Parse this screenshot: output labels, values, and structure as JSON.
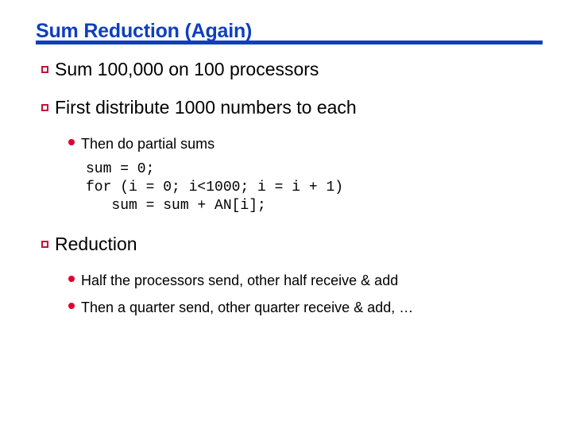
{
  "slide": {
    "title": "Sum Reduction (Again)",
    "title_color": "#0F3FBF",
    "bullet_square_color": "#C8103C",
    "bullet_dot_color": "#E00030",
    "background_color": "#FFFFFF",
    "text_color": "#000000",
    "bullets": [
      {
        "level": 1,
        "marker": "hollow-square-bullet",
        "text": "Sum 100,000 on 100 processors"
      },
      {
        "level": 1,
        "marker": "hollow-square-bullet",
        "text": "First distribute 1000 numbers to each"
      },
      {
        "level": 2,
        "marker": "filled-round-bullet",
        "text": "Then do partial sums"
      },
      {
        "level": 1,
        "marker": "hollow-square-bullet",
        "text": "Reduction"
      },
      {
        "level": 2,
        "marker": "filled-round-bullet",
        "text": "Half the processors send, other half receive & add"
      },
      {
        "level": 2,
        "marker": "filled-round-bullet",
        "text": "Then a quarter send, other quarter receive & add, …"
      }
    ],
    "code": {
      "line1": "sum = 0;",
      "line2": "for (i = 0; i<1000; i = i + 1)",
      "line3": "   sum = sum + AN[i];"
    }
  }
}
